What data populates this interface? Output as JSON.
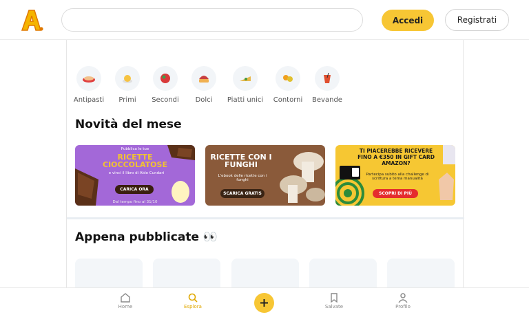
{
  "header": {
    "logo_text": "A.",
    "search": {
      "value": "",
      "placeholder": ""
    },
    "login_label": "Accedi",
    "register_label": "Registrati"
  },
  "categories": [
    {
      "label": "Antipasti",
      "icon": "antipasti-icon"
    },
    {
      "label": "Primi",
      "icon": "primi-icon"
    },
    {
      "label": "Secondi",
      "icon": "secondi-icon"
    },
    {
      "label": "Dolci",
      "icon": "dolci-icon"
    },
    {
      "label": "Piatti unici",
      "icon": "piatti-unici-icon"
    },
    {
      "label": "Contorni",
      "icon": "contorni-icon"
    },
    {
      "label": "Bevande",
      "icon": "bevande-icon"
    }
  ],
  "novita": {
    "title": "Novità del mese",
    "banners": [
      {
        "pre": "Pubblica le tue",
        "title": "RICETTE CIOCCOLATOSE",
        "sub": "e vinci il libro di Aldo Cundari",
        "button": "CARICA ORA",
        "foot": "Dal tempo fino al 31/10",
        "bg": "#a368d8",
        "accent": "#f1c232"
      },
      {
        "title": "RICETTE CON I FUNGHI",
        "sub": "L'ebook delle ricette con i funghi",
        "button": "SCARICA GRATIS",
        "bg": "#8a5a3a"
      },
      {
        "title": "TI PIACEREBBE RICEVERE FINO A €350 IN GIFT CARD AMAZON?",
        "sub": "Partecipa subito alla challenge di scrittura a tema manualità",
        "button": "SCOPRI DI PIÙ",
        "bg": "#f6c733",
        "button_color": "#e52d2d"
      }
    ]
  },
  "appena": {
    "title": "Appena pubblicate 👀"
  },
  "bottom_nav": {
    "items": [
      {
        "label": "Home",
        "icon": "home-icon"
      },
      {
        "label": "Esplora",
        "icon": "search-icon",
        "active": true
      },
      {
        "label": "Salvate",
        "icon": "bookmark-icon"
      },
      {
        "label": "Profilo",
        "icon": "profile-icon"
      }
    ],
    "fab_icon": "plus-icon"
  },
  "colors": {
    "accent": "#f7c634",
    "active_nav": "#e0a800"
  }
}
